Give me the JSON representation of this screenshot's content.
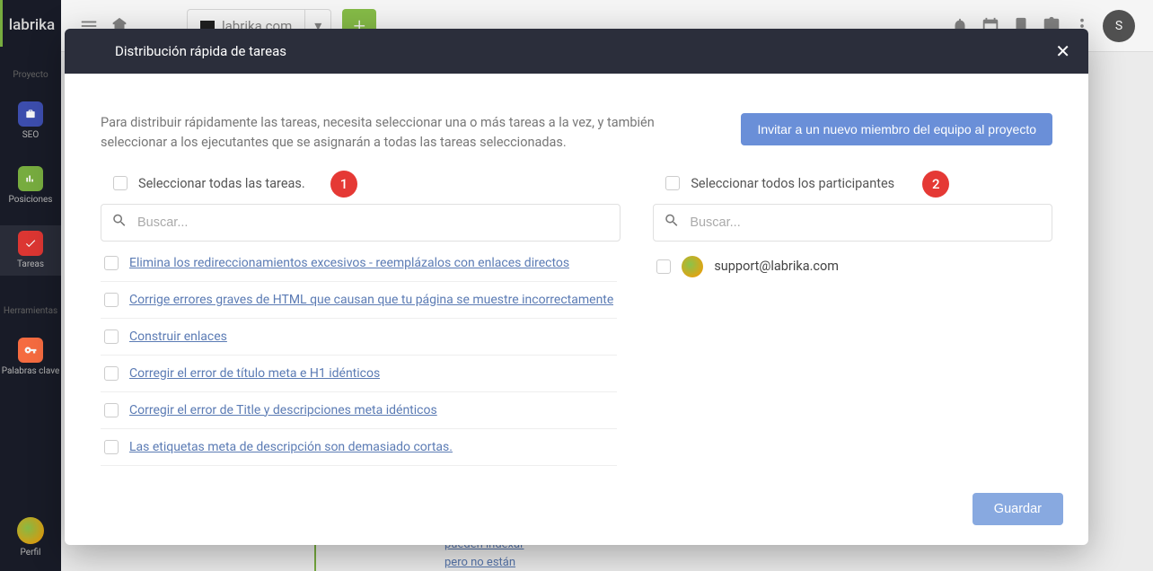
{
  "brand": "labrika",
  "sidebar": {
    "section1": "Proyecto",
    "seo": "SEO",
    "posiciones": "Posiciones",
    "tareas": "Tareas",
    "section2": "Herramientas",
    "palabras_clave": "Palabras clave",
    "perfil": "Perfil"
  },
  "topbar": {
    "site": "labrika.com",
    "avatar_letter": "S"
  },
  "bg": {
    "line1": "pueden indexar",
    "line2": "pero no están"
  },
  "modal": {
    "title": "Distribución rápida de tareas",
    "description": "Para distribuir rápidamente las tareas, necesita seleccionar una o más tareas a la vez, y también seleccionar a los ejecutantes que se asignarán a todas las tareas seleccionadas.",
    "invite_label": "Invitar a un nuevo miembro del equipo al proyecto",
    "select_all_tasks": "Seleccionar todas las tareas.",
    "select_all_participants": "Seleccionar todos los participantes",
    "search_placeholder": "Buscar...",
    "badge1": "1",
    "badge2": "2",
    "save_label": "Guardar",
    "tasks": [
      "Elimina los redireccionamientos excesivos - reemplázalos con enlaces directos",
      "Corrige errores graves de HTML que causan que tu página se muestre incorrectamente",
      "Construir enlaces",
      "Corregir el error de título meta e H1 idénticos",
      "Corregir el error de Title y descripciones meta idénticos",
      "Las etiquetas meta de descripción son demasiado cortas."
    ],
    "participants": [
      "support@labrika.com"
    ]
  }
}
